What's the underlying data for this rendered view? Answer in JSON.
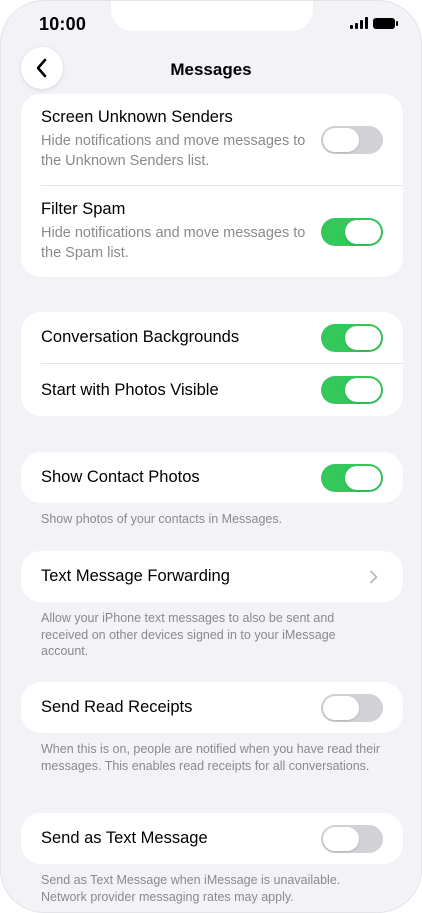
{
  "status_bar": {
    "time": "10:00",
    "signal_icon": "cellular-signal-icon",
    "battery_icon": "battery-icon"
  },
  "nav": {
    "title": "Messages",
    "back_icon": "chevron-left-icon"
  },
  "section1": {
    "rows": [
      {
        "title": "Screen Unknown Senders",
        "subtitle": "Hide notifications and move messages to the Unknown Senders list.",
        "toggle": "off"
      },
      {
        "title": "Filter Spam",
        "subtitle": "Hide notifications and move messages to the Spam list.",
        "toggle": "on"
      }
    ]
  },
  "section2": {
    "rows": [
      {
        "title": "Conversation Backgrounds",
        "toggle": "on"
      },
      {
        "title": "Start with Photos Visible",
        "toggle": "on"
      }
    ]
  },
  "section3": {
    "row": {
      "title": "Show Contact Photos",
      "toggle": "on"
    },
    "footnote": "Show photos of your contacts in Messages."
  },
  "section4": {
    "row": {
      "title": "Text Message Forwarding",
      "chevron_icon": "chevron-right-icon"
    },
    "footnote": "Allow your iPhone text messages to also be sent and received on other devices signed in to your iMessage account."
  },
  "section5": {
    "row": {
      "title": "Send Read Receipts",
      "toggle": "off"
    },
    "footnote": "When this is on, people are notified when you have read their messages. This enables read receipts for all conversations."
  },
  "section6": {
    "row": {
      "title": "Send as Text Message",
      "toggle": "off"
    },
    "footnote": "Send as Text Message when iMessage is unavailable. Network provider messaging rates may apply."
  },
  "colors": {
    "toggle_on": "#34c759",
    "toggle_off": "#d1d1d6",
    "background": "#f2f2f7",
    "secondary_text": "#8a8a8e"
  }
}
